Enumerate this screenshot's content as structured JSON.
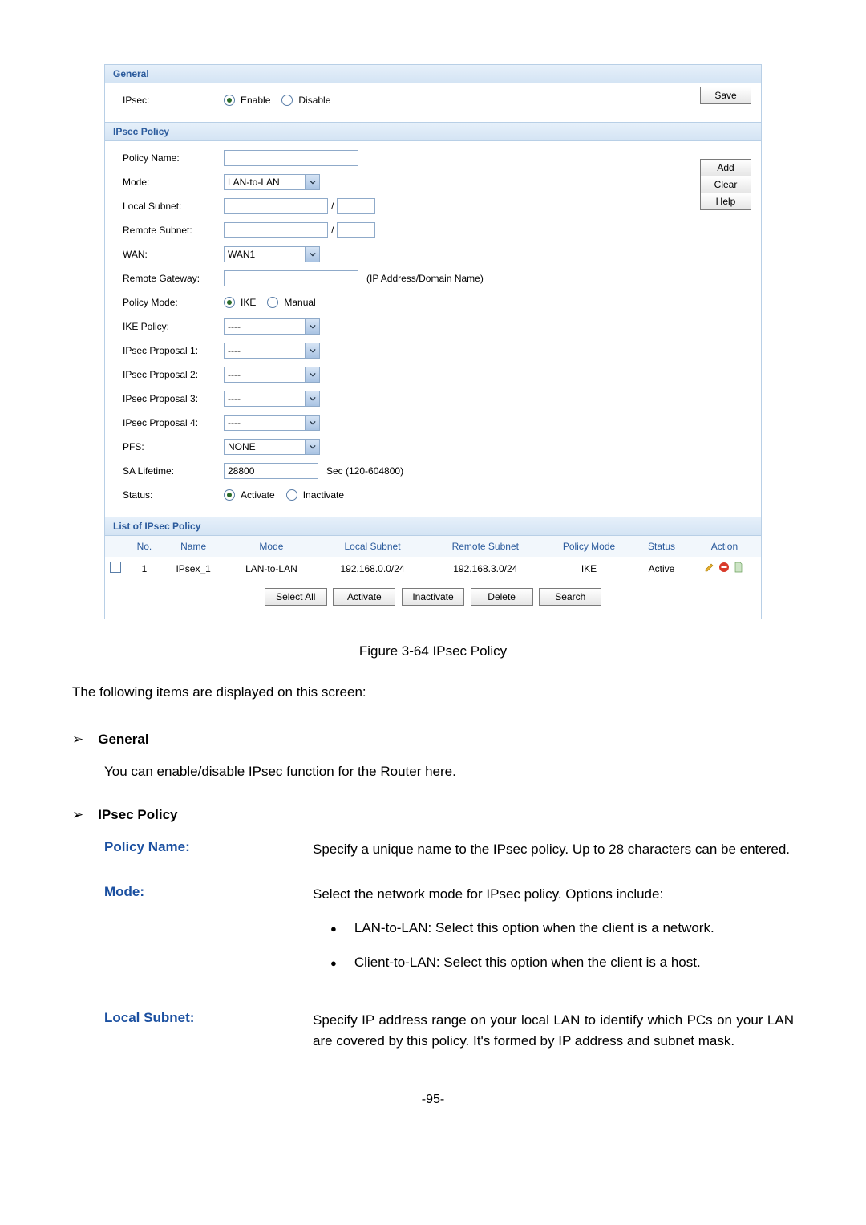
{
  "panel": {
    "general": {
      "header": "General",
      "ipsec_label": "IPsec:",
      "enable": "Enable",
      "disable": "Disable",
      "save": "Save"
    },
    "policy": {
      "header": "IPsec Policy",
      "policy_name_label": "Policy Name:",
      "mode_label": "Mode:",
      "mode_value": "LAN-to-LAN",
      "local_subnet_label": "Local Subnet:",
      "remote_subnet_label": "Remote Subnet:",
      "slash": "/",
      "wan_label": "WAN:",
      "wan_value": "WAN1",
      "remote_gateway_label": "Remote Gateway:",
      "remote_gateway_hint": "(IP Address/Domain Name)",
      "policy_mode_label": "Policy Mode:",
      "policy_mode_ike": "IKE",
      "policy_mode_manual": "Manual",
      "ike_policy_label": "IKE Policy:",
      "dashes": "----",
      "ipsec_p1_label": "IPsec Proposal 1:",
      "ipsec_p2_label": "IPsec Proposal 2:",
      "ipsec_p3_label": "IPsec Proposal 3:",
      "ipsec_p4_label": "IPsec Proposal 4:",
      "pfs_label": "PFS:",
      "pfs_value": "NONE",
      "sa_label": "SA Lifetime:",
      "sa_value": "28800",
      "sa_hint": "Sec (120-604800)",
      "status_label": "Status:",
      "status_activate": "Activate",
      "status_inactivate": "Inactivate",
      "buttons": {
        "add": "Add",
        "clear": "Clear",
        "help": "Help"
      }
    },
    "list": {
      "header": "List of IPsec Policy",
      "cols": {
        "no": "No.",
        "name": "Name",
        "mode": "Mode",
        "local": "Local Subnet",
        "remote": "Remote Subnet",
        "pmode": "Policy Mode",
        "status": "Status",
        "action": "Action"
      },
      "row": {
        "no": "1",
        "name": "IPsex_1",
        "mode": "LAN-to-LAN",
        "local": "192.168.0.0/24",
        "remote": "192.168.3.0/24",
        "pmode": "IKE",
        "status": "Active"
      },
      "footer": {
        "select_all": "Select All",
        "activate": "Activate",
        "inactivate": "Inactivate",
        "delete": "Delete",
        "search": "Search"
      }
    }
  },
  "doc": {
    "caption": "Figure 3-64 IPsec Policy",
    "intro": "The following items are displayed on this screen:",
    "h1": "General",
    "h1_body": "You can enable/disable IPsec function for the Router here.",
    "h2": "IPsec Policy",
    "policy_name_term": "Policy Name:",
    "policy_name_desc": "Specify a unique name to the IPsec policy. Up to 28 characters can be entered.",
    "mode_term": "Mode:",
    "mode_desc": "Select the network mode for IPsec policy. Options include:",
    "mode_b1": "LAN-to-LAN: Select this option when the client is a network.",
    "mode_b2": "Client-to-LAN: Select this option when the client is a host.",
    "local_term": "Local Subnet:",
    "local_desc": "Specify IP address range on your local LAN to identify which PCs on your LAN are covered by this policy. It's formed by IP address and subnet mask.",
    "page": "-95-"
  }
}
